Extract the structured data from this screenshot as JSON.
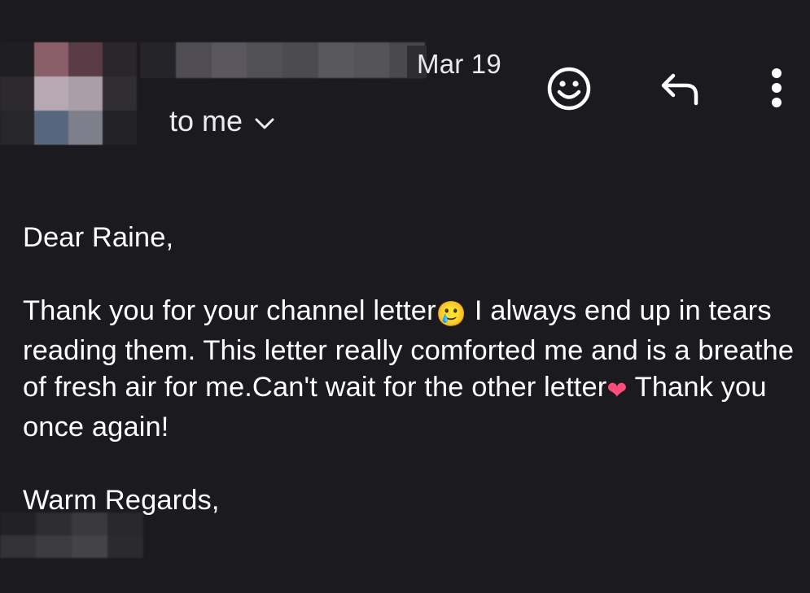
{
  "header": {
    "date": "Mar 19",
    "recipient_label": "to me",
    "icons": {
      "react": "smiley-icon",
      "reply": "reply-icon",
      "more": "more-vertical-icon",
      "expand": "chevron-down-icon"
    }
  },
  "message": {
    "greeting": "Dear Raine,",
    "paragraph": {
      "part1": "Thank you for your channel letter",
      "emoji1": "🥲",
      "part2": " I always end up in tears reading them. This letter really comforted me and is a breathe of fresh air for me.Can't wait for the other letter",
      "emoji2": "❤",
      "part3": " Thank you once again!"
    },
    "closing": "Warm Regards,"
  },
  "colors": {
    "background": "#1b1a1e",
    "text": "#ffffff",
    "icon": "#ffffff"
  }
}
